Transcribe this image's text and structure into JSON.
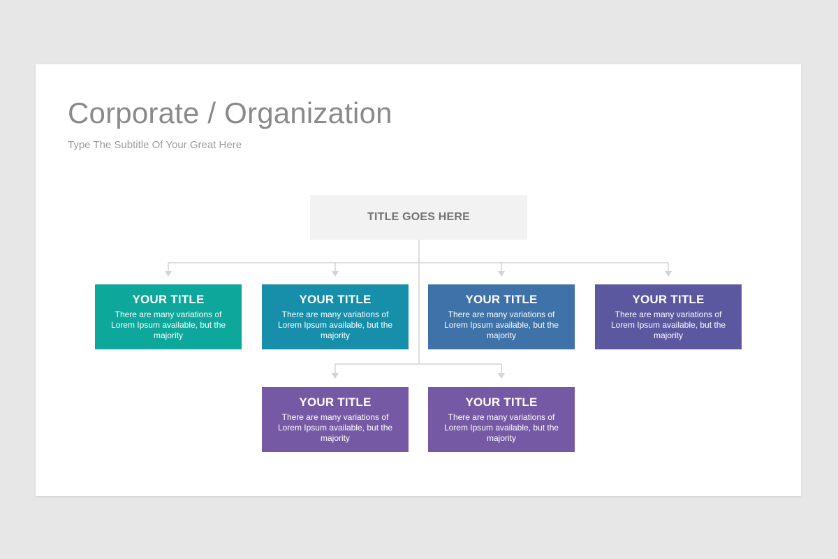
{
  "slide": {
    "title": "Corporate / Organization",
    "subtitle": "Type The Subtitle Of Your Great Here"
  },
  "root": {
    "label": "TITLE GOES HERE"
  },
  "nodes": [
    {
      "title": "YOUR TITLE",
      "text": "There are many variations  of Lorem Ipsum available, but the majority",
      "color": "#0ea79b"
    },
    {
      "title": "YOUR TITLE",
      "text": "There are many variations  of Lorem Ipsum available, but the majority",
      "color": "#178fab"
    },
    {
      "title": "YOUR TITLE",
      "text": "There are many variations  of Lorem Ipsum available, but the majority",
      "color": "#3e72a8"
    },
    {
      "title": "YOUR TITLE",
      "text": "There are many variations  of Lorem Ipsum available, but the majority",
      "color": "#5c58a0"
    },
    {
      "title": "YOUR TITLE",
      "text": "There are many variations  of Lorem Ipsum available, but the majority",
      "color": "#7659a4"
    },
    {
      "title": "YOUR TITLE",
      "text": "There are many variations  of Lorem Ipsum available, but the majority",
      "color": "#7659a4"
    }
  ],
  "colors": {
    "background": "#e8e7e8",
    "slide": "#ffffff",
    "connector": "#d4d4d4",
    "root_fill": "#f2f2f2"
  }
}
